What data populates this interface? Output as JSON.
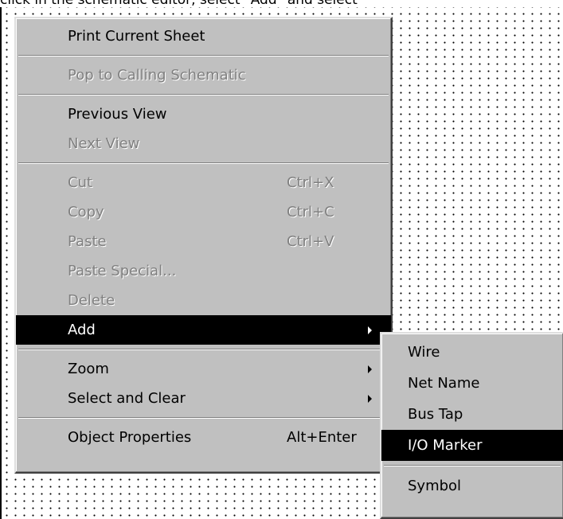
{
  "caption": "click in the schematic editor, select \"Add\" and select",
  "main_menu": {
    "print_current_sheet": "Print Current Sheet",
    "pop_to_calling": "Pop to Calling Schematic",
    "previous_view": "Previous View",
    "next_view": "Next View",
    "cut": "Cut",
    "cut_shortcut": "Ctrl+X",
    "copy": "Copy",
    "copy_shortcut": "Ctrl+C",
    "paste": "Paste",
    "paste_shortcut": "Ctrl+V",
    "paste_special": "Paste Special...",
    "delete": "Delete",
    "add": "Add",
    "zoom": "Zoom",
    "select_and_clear": "Select and Clear",
    "object_properties": "Object Properties",
    "object_properties_shortcut": "Alt+Enter"
  },
  "add_submenu": {
    "wire": "Wire",
    "net_name": "Net Name",
    "bus_tap": "Bus Tap",
    "io_marker": "I/O Marker",
    "symbol": "Symbol"
  },
  "colors": {
    "menu_face": "#c0c0c0",
    "highlight": "#000000",
    "disabled_text": "#808080"
  }
}
